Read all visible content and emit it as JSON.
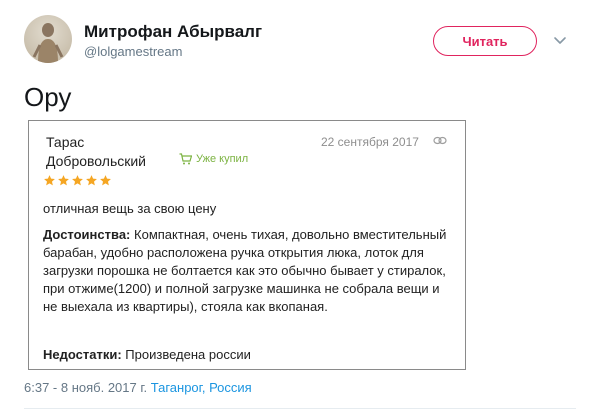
{
  "tweet": {
    "display_name": "Митрофан Абырвалг",
    "handle": "@lolgamestream",
    "follow_label": "Читать",
    "text": "Ору",
    "timestamp": "6:37 - 8 нояб. 2017 г.",
    "location_city": "Таганрог",
    "location_separator": ",",
    "location_country": "Россия"
  },
  "review": {
    "name_first": "Тарас",
    "name_last": "Добровольский",
    "purchased_label": "Уже купил",
    "date": "22 сентября 2017",
    "rating": 5,
    "star_color": "#f5a623",
    "title": "отличная вещь за свою цену",
    "pros_label": "Достоинства:",
    "pros_text": "Компактная, очень тихая, довольно вместительный барабан, удобно расположена ручка открытия люка, лоток для загрузки порошка не болтается как это обычно бывает у стиралок, при отжиме(1200) и полной загрузке машинка не собрала вещи и не выехала из квартиры), стояла как вкопаная.",
    "cons_label": "Недостатки:",
    "cons_text": "Произведена россии"
  },
  "colors": {
    "follow_accent": "#e0245e",
    "link": "#1b95e0",
    "purchased": "#7cb342"
  },
  "icons": {
    "chevron": "chevron-down-icon",
    "cart": "cart-icon",
    "link": "link-icon"
  }
}
